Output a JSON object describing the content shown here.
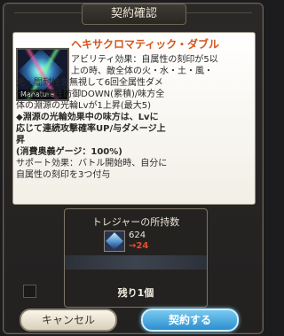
{
  "dialog": {
    "title": "契約確認"
  },
  "item": {
    "image_caption": "Manatura",
    "skill_name": "ヘキサクロマティック・ダブル",
    "description_lines": [
      "アビリティ効果：自属性の刻印が5以",
      "上の時、敵全体の火・水・土・風・",
      "光・闇耐性を無視して6回全属性ダメ",
      "ージ/全属性防御DOWN(累積)/味方全",
      "体の淵源の光輪Lvが1上昇(最大5)",
      "◆淵源の光輪効果中の味方は、Lvに",
      "応じて連続攻撃確率UP/与ダメージ上",
      "昇",
      "(消費奥義ゲージ：100%)",
      "サポート効果：バトル開始時、自分に",
      "自属性の刻印を3つ付与"
    ]
  },
  "treasure": {
    "title": "トレジャーの所持数",
    "count": "624",
    "after": "→24"
  },
  "remaining": "残り1個",
  "buttons": {
    "cancel": "キャンセル",
    "confirm": "契約する"
  }
}
